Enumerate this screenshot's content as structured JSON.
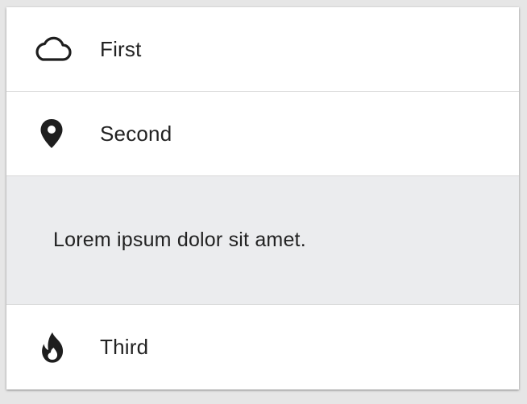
{
  "accordion": {
    "items": [
      {
        "label": "First",
        "icon": "cloud-icon"
      },
      {
        "label": "Second",
        "icon": "map-marker-icon"
      },
      {
        "label": "Third",
        "icon": "fire-icon"
      }
    ],
    "expanded_content": "Lorem ipsum dolor sit amet."
  },
  "colors": {
    "background": "#e6e6e6",
    "row_background": "#ffffff",
    "expanded_background": "#ebecee",
    "text": "#222222",
    "divider": "#d9d9d9"
  }
}
